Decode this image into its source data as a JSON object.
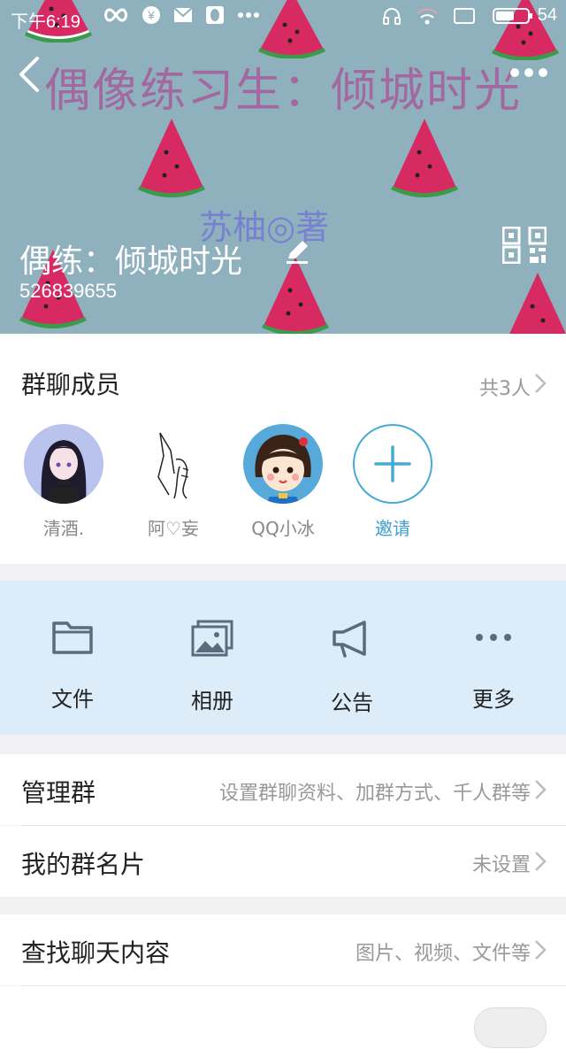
{
  "status_bar": {
    "time": "下午6:19",
    "battery": "54"
  },
  "header": {
    "banner_text": "偶像练习生：倾城时光",
    "author_text": "苏柚◎著",
    "group_name": "偶练：倾城时光",
    "group_id": "526839655",
    "colors": {
      "background": "#8fb1bd",
      "banner": "#a65c9a",
      "author": "#6e6ed7"
    }
  },
  "members": {
    "title": "群聊成员",
    "count": "共3人",
    "items": [
      {
        "name": "清酒."
      },
      {
        "name": "阿♡妄"
      },
      {
        "name": "QQ小冰"
      }
    ],
    "invite_label": "邀请"
  },
  "tools": [
    {
      "label": "文件",
      "icon": "folder-icon"
    },
    {
      "label": "相册",
      "icon": "album-icon"
    },
    {
      "label": "公告",
      "icon": "announcement-icon"
    },
    {
      "label": "更多",
      "icon": "more-icon"
    }
  ],
  "settings": {
    "manage": {
      "title": "管理群",
      "value": "设置群聊资料、加群方式、千人群等"
    },
    "card": {
      "title": "我的群名片",
      "value": "未设置"
    },
    "search": {
      "title": "查找聊天内容",
      "value": "图片、视频、文件等"
    }
  },
  "accent_color": "#47a9d4"
}
